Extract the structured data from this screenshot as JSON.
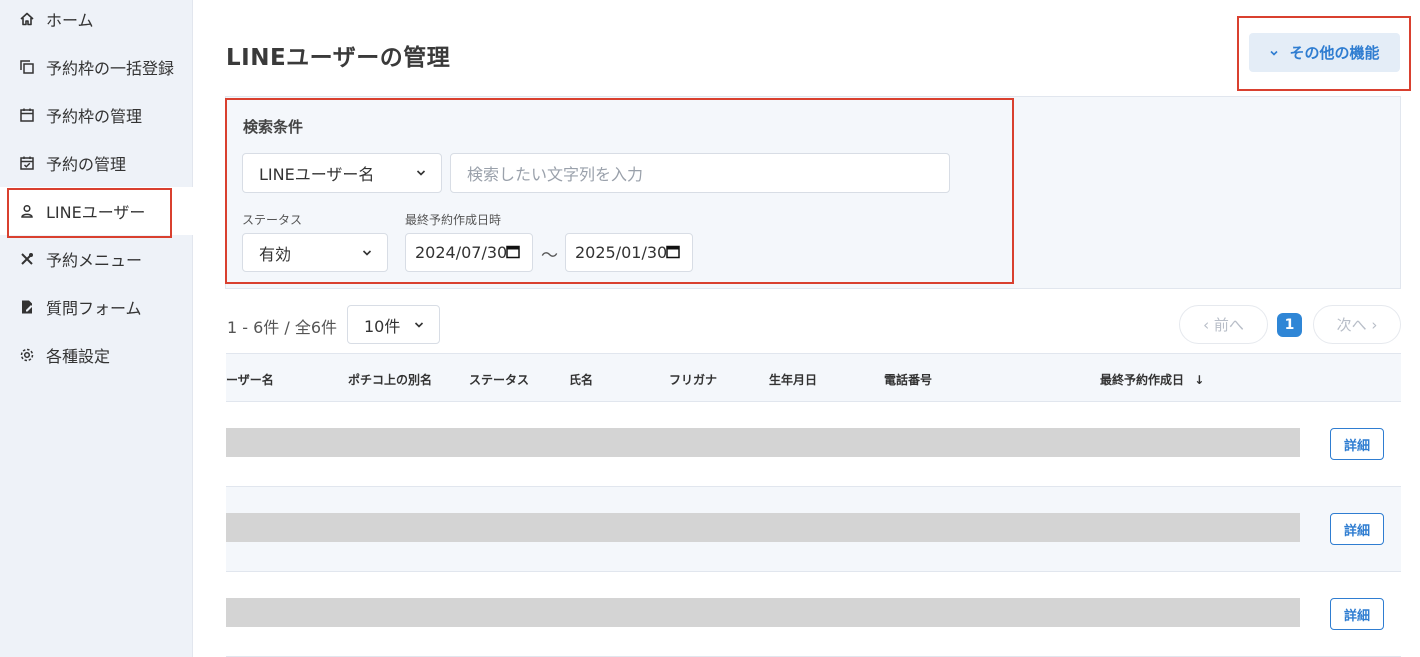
{
  "sidebar": {
    "items": [
      {
        "label": "ホーム",
        "icon": "home-icon"
      },
      {
        "label": "予約枠の一括登録",
        "icon": "copy-icon"
      },
      {
        "label": "予約枠の管理",
        "icon": "calendar-icon"
      },
      {
        "label": "予約の管理",
        "icon": "calendar-check-icon"
      },
      {
        "label": "LINEユーザー",
        "icon": "user-icon"
      },
      {
        "label": "予約メニュー",
        "icon": "utensils-icon"
      },
      {
        "label": "質問フォーム",
        "icon": "form-edit-icon"
      },
      {
        "label": "各種設定",
        "icon": "gear-icon"
      }
    ],
    "active": "LINEユーザー"
  },
  "header": {
    "title": "LINEユーザーの管理",
    "more_button": "その他の機能"
  },
  "search": {
    "title": "検索条件",
    "field_select": "LINEユーザー名",
    "keyword_placeholder": "検索したい文字列を入力",
    "status_label": "ステータス",
    "status_value": "有効",
    "date_label": "最終予約作成日時",
    "date_from": "2024/07/30",
    "date_separator": "〜",
    "date_to": "2025/01/30"
  },
  "pagination": {
    "count_text": "1 - 6件 / 全6件",
    "per_page": "10件",
    "prev": "‹ 前へ",
    "current_page": "1",
    "next": "次へ ›"
  },
  "table": {
    "columns": [
      "ーザー名",
      "ポチコ上の別名",
      "ステータス",
      "氏名",
      "フリガナ",
      "生年月日",
      "電話番号",
      "最終予約作成日"
    ],
    "sort_indicator": "↓",
    "row_count": 3,
    "detail_label": "詳細"
  },
  "colors": {
    "accent": "#2f7dd1",
    "highlight": "#d9402f",
    "sidebar_bg": "#eef2f8"
  }
}
